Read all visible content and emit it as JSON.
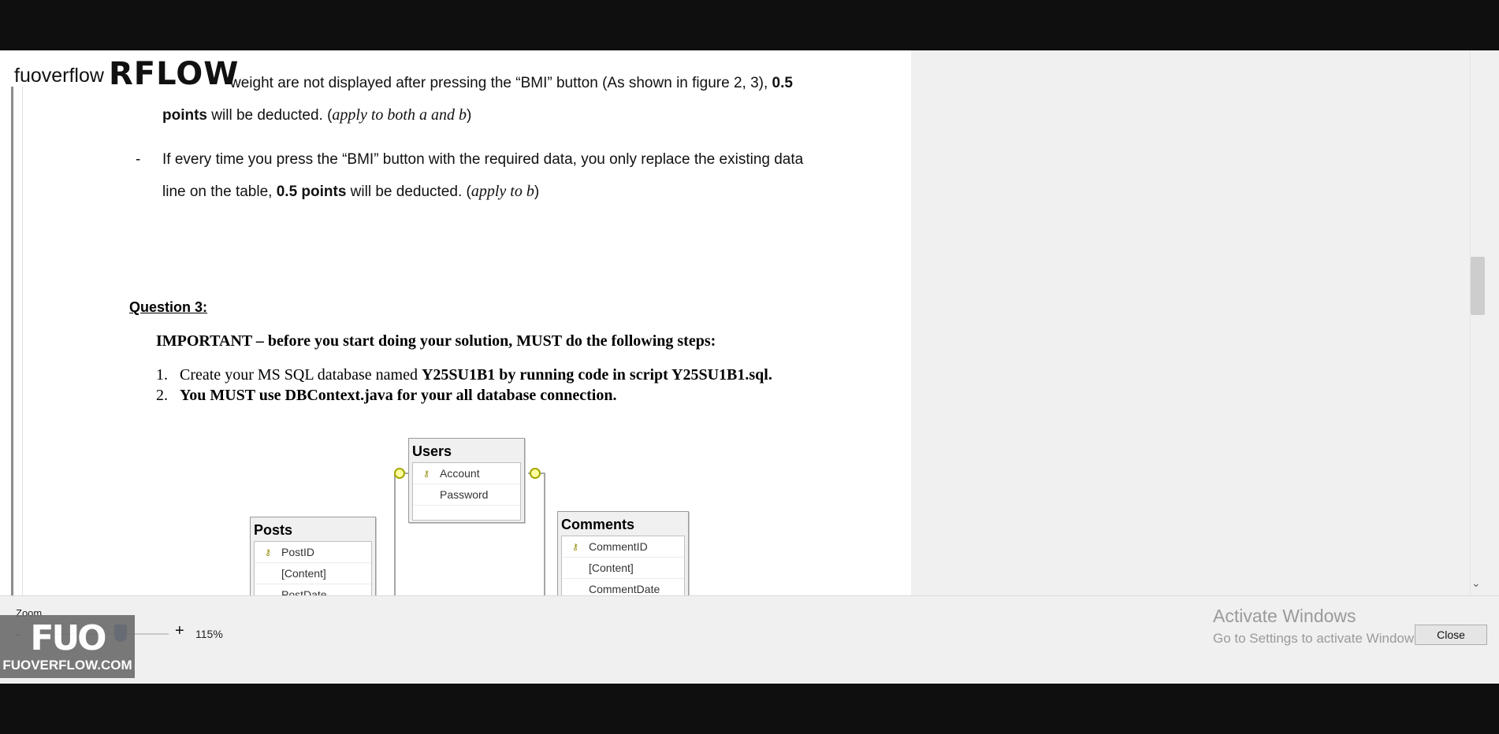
{
  "watermark": {
    "text": "fuoverflow",
    "logo": "RFLOW",
    "badge_mark": "FUO",
    "badge_site": "FUOVERFLOW.COM"
  },
  "document": {
    "line1": "weight are not displayed after pressing the “BMI” button (As shown in figure 2, 3), ",
    "line1_bold": "0.5",
    "line2_bold": "points",
    "line2": " will be deducted. (",
    "line2_italic": "apply to both a and b",
    "line2_end": ")",
    "bullet": "-",
    "line3": "If every time you press the “BMI” button with the required data, you only replace the existing data",
    "line4": "line on the table, ",
    "line4_bold": "0.5 points",
    "line4_mid": " will be deducted. (",
    "line4_italic": "apply to b",
    "line4_end": ")",
    "question_heading": "Question 3:",
    "important": "IMPORTANT – before you start doing your solution, MUST do the following steps:",
    "steps": [
      {
        "num": "1.",
        "text_plain": "Create your MS SQL database named ",
        "text_bold": "Y25SU1B1 by running code in script Y25SU1B1.sql."
      },
      {
        "num": "2.",
        "text_plain": "",
        "text_bold": "You MUST use DBContext.java for your all database connection."
      }
    ]
  },
  "diagram": {
    "tables": [
      {
        "name": "Users",
        "columns": [
          {
            "name": "Account",
            "key": true
          },
          {
            "name": "Password",
            "key": false
          }
        ]
      },
      {
        "name": "Posts",
        "columns": [
          {
            "name": "PostID",
            "key": true
          },
          {
            "name": "[Content]",
            "key": false
          },
          {
            "name": "PostDate",
            "key": false
          }
        ]
      },
      {
        "name": "Comments",
        "columns": [
          {
            "name": "CommentID",
            "key": true
          },
          {
            "name": "[Content]",
            "key": false
          },
          {
            "name": "CommentDate",
            "key": false
          }
        ]
      }
    ]
  },
  "viewer": {
    "zoom_label": "Zoom",
    "zoom_minus": "-",
    "zoom_plus": "+",
    "zoom_value": "115%",
    "zoom_level_percent": 115,
    "close_label": "Close",
    "scroll_down_glyph": "⌄"
  },
  "activation": {
    "title": "Activate Windows",
    "subtitle": "Go to Settings to activate Windows."
  },
  "colors": {
    "letterbox": "#0f0f0f",
    "panel": "#f0f0f0",
    "zoom_thumb": "#1f5fbf"
  }
}
